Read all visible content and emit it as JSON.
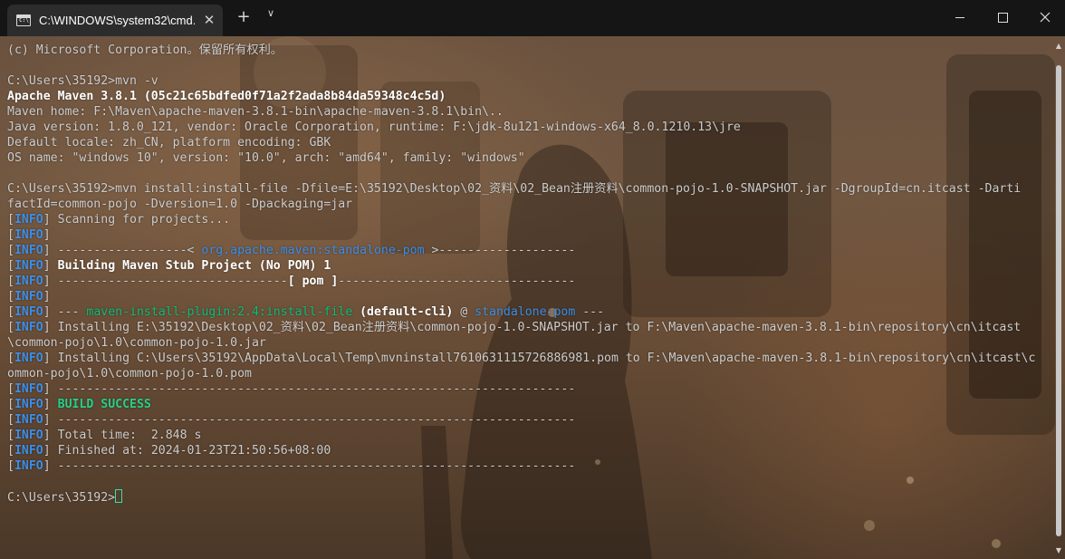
{
  "window": {
    "tab_title": "C:\\WINDOWS\\system32\\cmd.",
    "tab_close": "✕",
    "new_tab": "+",
    "dropdown": "∨",
    "icon": "terminal-icon",
    "icon_text": "C:\\"
  },
  "terminal": {
    "colors": {
      "text": "#cccccc",
      "bright": "#ffffff",
      "info": "#3b8eea",
      "success": "#23d18b",
      "plugin": "#0dbc79",
      "cursor": "#33e0b0"
    },
    "lines": [
      "(c) Microsoft Corporation。保留所有权利。",
      "",
      "C:\\Users\\35192>mvn -v",
      "Apache Maven 3.8.1 (05c21c65bdfed0f71a2f2ada8b84da59348c4c5d)",
      "Maven home: F:\\Maven\\apache-maven-3.8.1-bin\\apache-maven-3.8.1\\bin\\..",
      "Java version: 1.8.0_121, vendor: Oracle Corporation, runtime: F:\\jdk-8u121-windows-x64_8.0.1210.13\\jre",
      "Default locale: zh_CN, platform encoding: GBK",
      "OS name: \"windows 10\", version: \"10.0\", arch: \"amd64\", family: \"windows\"",
      "",
      "C:\\Users\\35192>mvn install:install-file -Dfile=E:\\35192\\Desktop\\02_资料\\02_Bean注册资料\\common-pojo-1.0-SNAPSHOT.jar -DgroupId=cn.itcast -Darti",
      "factId=common-pojo -Dversion=1.0 -Dpackaging=jar",
      "[INFO] Scanning for projects...",
      "[INFO]",
      "[INFO] ------------------< org.apache.maven:standalone-pom >-------------------",
      "[INFO] Building Maven Stub Project (No POM) 1",
      "[INFO] --------------------------------[ pom ]---------------------------------",
      "[INFO]",
      "[INFO] --- maven-install-plugin:2.4:install-file (default-cli) @ standalone-pom ---",
      "[INFO] Installing E:\\35192\\Desktop\\02_资料\\02_Bean注册资料\\common-pojo-1.0-SNAPSHOT.jar to F:\\Maven\\apache-maven-3.8.1-bin\\repository\\cn\\itcast",
      "\\common-pojo\\1.0\\common-pojo-1.0.jar",
      "[INFO] Installing C:\\Users\\35192\\AppData\\Local\\Temp\\mvninstall7610631115726886981.pom to F:\\Maven\\apache-maven-3.8.1-bin\\repository\\cn\\itcast\\c",
      "ommon-pojo\\1.0\\common-pojo-1.0.pom",
      "[INFO] ------------------------------------------------------------------------",
      "[INFO] BUILD SUCCESS",
      "[INFO] ------------------------------------------------------------------------",
      "[INFO] Total time:  2.848 s",
      "[INFO] Finished at: 2024-01-23T21:50:56+08:00",
      "[INFO] ------------------------------------------------------------------------",
      "",
      "C:\\Users\\35192>"
    ]
  }
}
